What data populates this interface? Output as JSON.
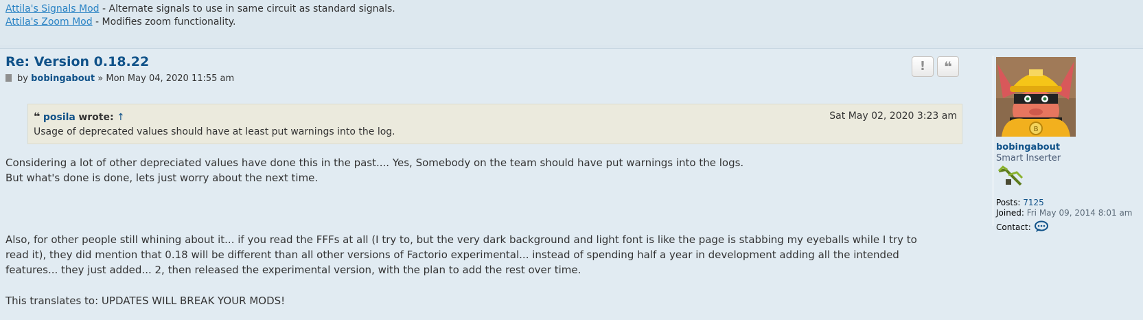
{
  "prev_post": {
    "mods": [
      {
        "link": "Attila's Signals Mod",
        "desc": " - Alternate signals to use in same circuit as standard signals."
      },
      {
        "link": "Attila's Zoom Mod",
        "desc": " - Modifies zoom functionality."
      }
    ]
  },
  "post": {
    "title": "Re: Version 0.18.22",
    "by": "by",
    "author": "bobingabout",
    "sep": "»",
    "date": "Mon May 04, 2020 11:55 am",
    "buttons": {
      "report": "!",
      "quote": "❝"
    },
    "quote": {
      "icon": "❝",
      "author": "posila",
      "wrote": "wrote:",
      "arrow": "↑",
      "date": "Sat May 02, 2020 3:23 am",
      "text": "Usage of deprecated values should have at least put warnings into the log."
    },
    "body": [
      "Considering a lot of other depreciated values have done this in the past.... Yes, Somebody on the team should have put warnings into the logs.",
      "But what's done is done, lets just worry about the next time.",
      "Also, for other people still whining about it... if you read the FFFs at all (I try to, but the very dark background and light font is like the page is stabbing my eyeballs while I try to",
      "read it), they did mention that 0.18 will be different than all other versions of Factorio experimental... instead of spending half a year in development adding all the intended",
      "features... they just added... 2, then released the experimental version, with the plan to add the rest over time.",
      "This translates to: UPDATES WILL BREAK YOUR MODS!"
    ]
  },
  "profile": {
    "username": "bobingabout",
    "rank": "Smart Inserter",
    "posts_label": "Posts:",
    "posts_value": "7125",
    "joined_label": "Joined:",
    "joined_value": "Fri May 09, 2014 8:01 am",
    "contact_label": "Contact:"
  },
  "colors": {
    "link": "#105289",
    "mod_link": "#2a83c4",
    "quote_bg": "#ebeadd",
    "post_bg": "#e1ebf2"
  },
  "icons": [
    "document-icon",
    "report-icon",
    "quote-icon",
    "avatar",
    "rank-image",
    "contact-bubble-icon"
  ]
}
